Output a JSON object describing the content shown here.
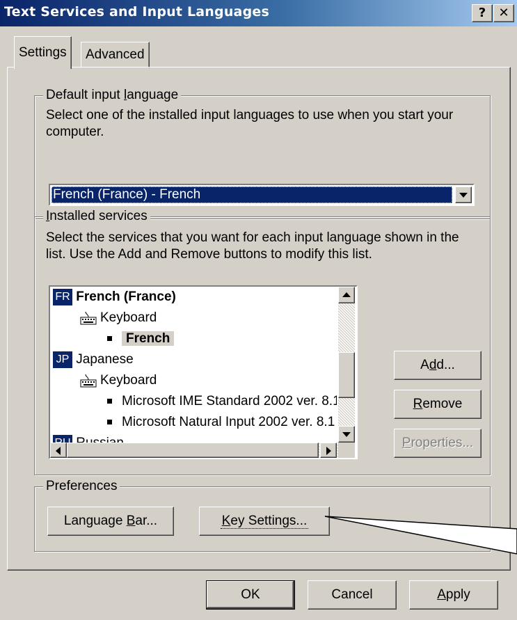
{
  "window": {
    "title": "Text Services and Input Languages",
    "help_glyph": "?",
    "close_glyph": "✕"
  },
  "tabs": [
    {
      "label": "Settings",
      "selected": true
    },
    {
      "label": "Advanced",
      "selected": false
    }
  ],
  "default_input": {
    "legend_pre": "Default input ",
    "legend_mnemonic": "l",
    "legend_post": "anguage",
    "description": "Select one of the installed input languages to use when you start your computer.",
    "selected_value": "French (France) - French"
  },
  "installed_services": {
    "legend_mnemonic": "I",
    "legend_post": "nstalled services",
    "description": "Select the services that you want for each input language shown in the list. Use the Add and Remove buttons to modify this list.",
    "tree": [
      {
        "badge": "FR",
        "label": "French (France)"
      },
      {
        "label": "Keyboard"
      },
      {
        "label": "French"
      },
      {
        "badge": "JP",
        "label": "Japanese"
      },
      {
        "label": "Keyboard"
      },
      {
        "label": "Microsoft IME Standard 2002 ver. 8.1"
      },
      {
        "label": "Microsoft Natural Input 2002 ver. 8.1"
      },
      {
        "badge": "RU",
        "label": "Russian"
      }
    ],
    "add_pre": "A",
    "add_mnemonic": "d",
    "add_post": "d...",
    "remove_mnemonic": "R",
    "remove_post": "emove",
    "properties_mnemonic": "P",
    "properties_post": "roperties..."
  },
  "preferences": {
    "legend": "Preferences",
    "language_bar_pre": "Language ",
    "language_bar_mnemonic": "B",
    "language_bar_post": "ar...",
    "key_settings_mnemonic": "K",
    "key_settings_post": "ey Settings..."
  },
  "footer": {
    "ok": "OK",
    "cancel": "Cancel",
    "apply_mnemonic": "A",
    "apply_post": "pply"
  },
  "colors": {
    "dialog_face": "#d4d0c8",
    "title_bar_start": "#0a246a",
    "title_bar_end": "#a6caf0",
    "selection": "#0a246a"
  }
}
